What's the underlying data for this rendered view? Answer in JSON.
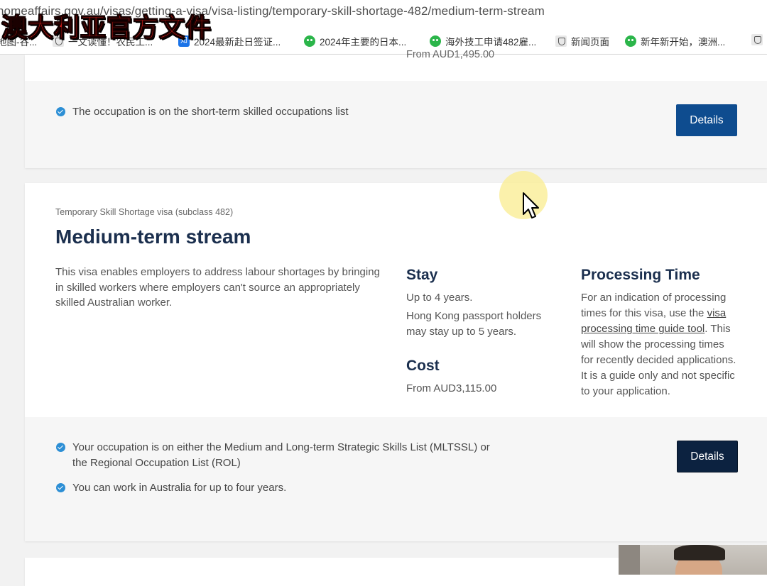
{
  "browser": {
    "url": "homeaffairs.gov.au/visas/getting-a-visa/visa-listing/temporary-skill-shortage-482/medium-term-stream",
    "overlay_title": "澳大利亚官方文件",
    "bookmarks": [
      {
        "label": "地图-谷...",
        "icon": "map-icon"
      },
      {
        "label": "一文读懂！农民工...",
        "icon": "doc-icon"
      },
      {
        "label": "2024最新赴日签证...",
        "icon": "zhihu-icon"
      },
      {
        "label": "2024年主要的日本...",
        "icon": "wechat-icon"
      },
      {
        "label": "海外技工申请482雇...",
        "icon": "wechat-icon"
      },
      {
        "label": "新闻页面",
        "icon": "gov-emblem-icon"
      },
      {
        "label": "新年新开始，澳洲...",
        "icon": "wechat-icon"
      }
    ]
  },
  "previous_card": {
    "cost_fragment": "From AUD1,495.00",
    "criterion": "The occupation is on the short-term skilled occupations list",
    "details_label": "Details"
  },
  "medium_term": {
    "subtitle": "Temporary Skill Shortage visa (subclass 482)",
    "title": "Medium-term stream",
    "description": "This visa enables employers to address labour shortages by bringing in skilled workers where employers can't source an appropriately skilled Australian worker.",
    "stay": {
      "heading": "Stay",
      "line1": "Up to 4 years.",
      "line2": "Hong Kong passport holders may stay up to 5 years."
    },
    "cost": {
      "heading": "Cost",
      "value": "From AUD3,115.00"
    },
    "processing": {
      "heading": "Processing Time",
      "text_before": "For an indication of processing times for this visa, use the ",
      "link": "visa processing time guide tool",
      "text_after": ". This will show the processing times for recently decided applications. It is a guide only and not specific to your application."
    },
    "criteria": [
      "Your occupation is on either the Medium and Long-term Strategic Skills List (MLTSSL) or the Regional Occupation List (ROL)",
      "You can work in Australia for up to four years."
    ],
    "details_label": "Details"
  },
  "colors": {
    "heading": "#1b2f4e",
    "button": "#0e4c8f",
    "button_dark": "#0c2240",
    "check": "#2d8fd5",
    "overlay_red": "#e0201a"
  }
}
